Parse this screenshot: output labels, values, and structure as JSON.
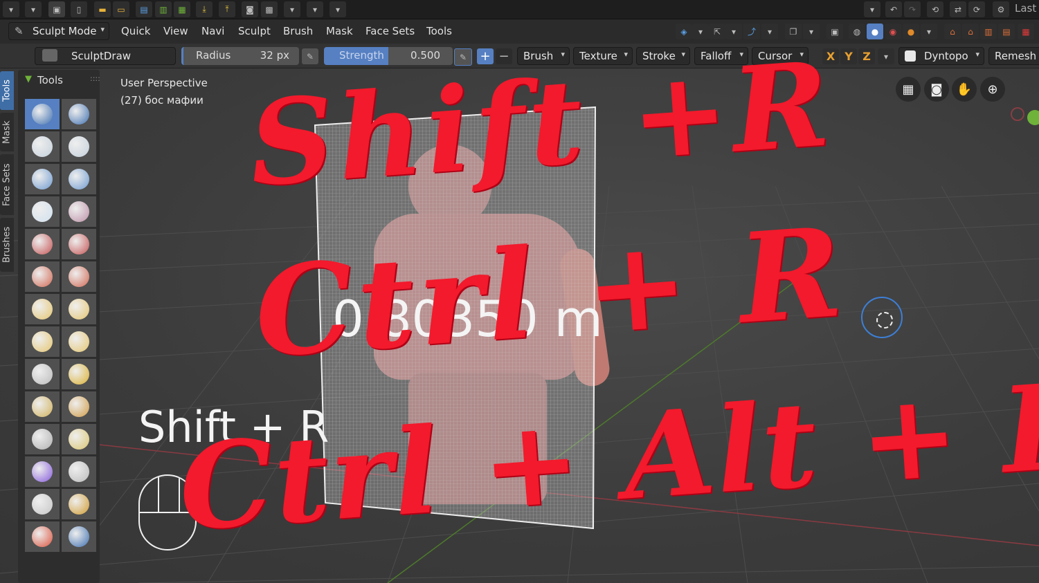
{
  "topbar": {
    "last_label": "Last",
    "icons": [
      "editor-type-dropdown",
      "new-file-icon",
      "file-icon",
      "open-folder-icon",
      "recent-folder-icon",
      "save-icon",
      "save-as-icon",
      "save-copy-icon",
      "import-icon",
      "export-icon",
      "render-icon",
      "film-icon",
      "undo-icon",
      "redo-icon",
      "history-icon",
      "sync-icon",
      "settings-icon"
    ]
  },
  "menubar": {
    "mode_label": "Sculpt Mode",
    "menus": [
      "Quick",
      "View",
      "Navi",
      "Sculpt",
      "Brush",
      "Mask",
      "Face Sets",
      "Tools"
    ]
  },
  "toolsettings": {
    "brush_name": "SculptDraw",
    "radius_label": "Radius",
    "radius_value": "32 px",
    "strength_label": "Strength",
    "strength_value": "0.500",
    "strength_fraction": 0.5,
    "plus": "+",
    "minus": "−",
    "dropdowns": [
      "Brush",
      "Texture",
      "Stroke",
      "Falloff",
      "Cursor"
    ],
    "axes": [
      "X",
      "Y",
      "Z"
    ],
    "dyntopo_label": "Dyntopo",
    "remesh_label": "Remesh"
  },
  "sidetabs": [
    "Tools",
    "Mask",
    "Face Sets",
    "Brushes"
  ],
  "toolpanel": {
    "header": "Tools"
  },
  "viewport": {
    "perspective": "User Perspective",
    "object_info": "(27) бос мафии",
    "measure_text": "0.80350 m",
    "shortcut_text": "Shift + R"
  },
  "overlay": {
    "line1": "Shift +R",
    "line2": "Ctrl + R",
    "line3": "Ctrl + Alt + R"
  },
  "colors": {
    "accent": "#5680c2",
    "overlay_red": "#f21a2c",
    "axis_x": "#e0414f",
    "axis_y": "#6fb33a",
    "axis_z": "#3d7fd6"
  }
}
